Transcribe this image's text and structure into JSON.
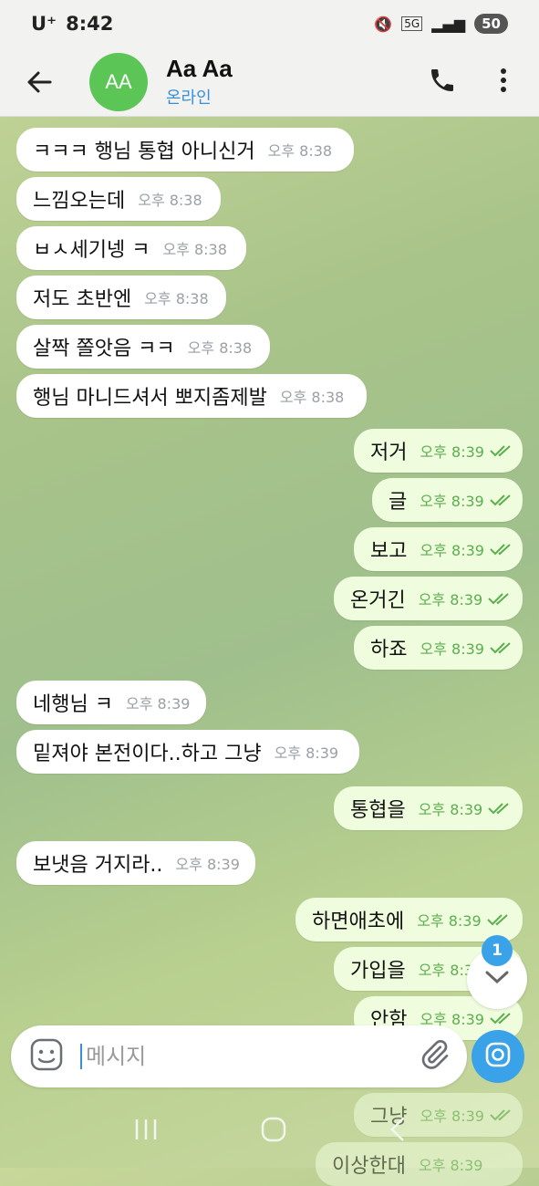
{
  "status": {
    "carrier": "U⁺",
    "time": "8:42",
    "network": "5G",
    "battery": "50"
  },
  "header": {
    "avatar_initials": "AA",
    "name": "Aa Aa",
    "status": "온라인"
  },
  "messages": [
    {
      "text": "ㅋㅋㅋ 행님 통협 아니신거",
      "time": "오후 8:38"
    },
    {
      "text": "느낌오는데",
      "time": "오후 8:38"
    },
    {
      "text": "ㅂㅅ세기넹 ㅋ",
      "time": "오후 8:38"
    },
    {
      "text": "저도 초반엔",
      "time": "오후 8:38"
    },
    {
      "text": "살짝 쫄앗음 ㅋㅋ",
      "time": "오후 8:38"
    },
    {
      "text": "행님 마니드셔서 뽀지좀제발",
      "time": "오후 8:38"
    },
    {
      "text": "저거",
      "time": "오후 8:39"
    },
    {
      "text": "글",
      "time": "오후 8:39"
    },
    {
      "text": "보고",
      "time": "오후 8:39"
    },
    {
      "text": "온거긴",
      "time": "오후 8:39"
    },
    {
      "text": "하죠",
      "time": "오후 8:39"
    },
    {
      "text": "네행님 ㅋ",
      "time": "오후 8:39"
    },
    {
      "text": "밑져야 본전이다..하고 그냥",
      "time": "오후 8:39"
    },
    {
      "text": "통협을",
      "time": "오후 8:39"
    },
    {
      "text": "보냇음 거지라..",
      "time": "오후 8:39"
    },
    {
      "text": "하면애초에",
      "time": "오후 8:39"
    },
    {
      "text": "가입을",
      "time": "오후 8:39"
    },
    {
      "text": "안함",
      "time": "오후 8:39"
    },
    {
      "text": "그냥",
      "time": "오후 8:39"
    },
    {
      "text": "이상한대",
      "time": "오후 8:39"
    }
  ],
  "input": {
    "placeholder": "메시지"
  },
  "unread_count": "1"
}
